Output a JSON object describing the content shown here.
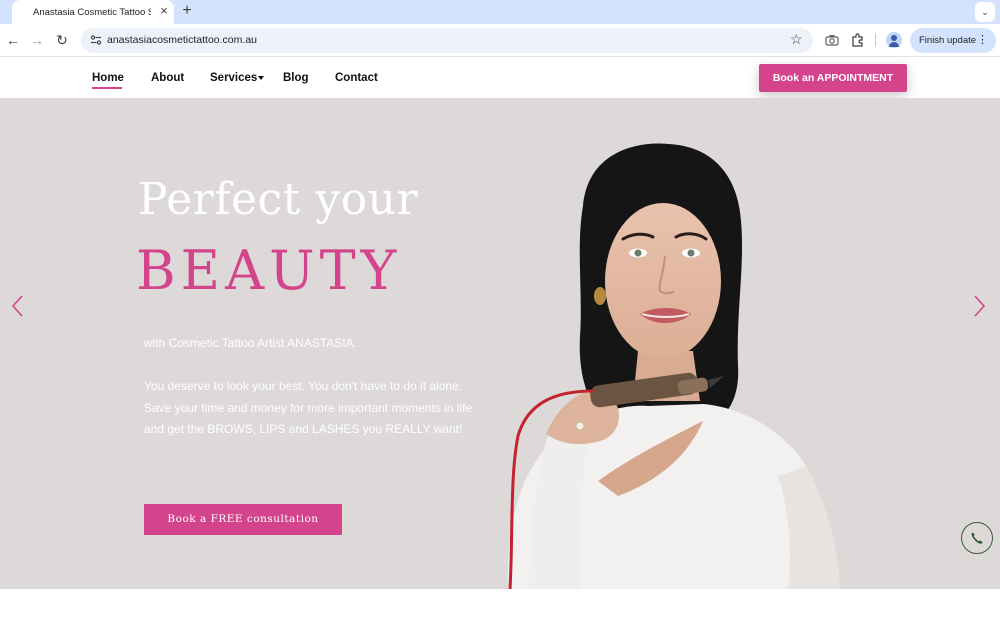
{
  "browser": {
    "tab_title": "Anastasia Cosmetic Tattoo St",
    "tab_close": "×",
    "new_tab": "+",
    "tab_menu": "⌄",
    "back": "←",
    "forward": "→",
    "reload": "↻",
    "url": "anastasiacosmetictattoo.com.au",
    "bookmark_star": "☆",
    "finish_update_label": "Finish update",
    "menu_dots": "⋮"
  },
  "nav": {
    "items": [
      {
        "label": "Home",
        "active": true
      },
      {
        "label": "About"
      },
      {
        "label": "Services",
        "has_dropdown": true
      },
      {
        "label": "Blog"
      },
      {
        "label": "Contact"
      }
    ],
    "book_button": "Book an APPOINTMENT"
  },
  "hero": {
    "title_line1": "Perfect your",
    "title_line2": "BEAUTY",
    "subtitle": "with Cosmetic Tattoo Artist ANASTASIA.",
    "body_line1": "You deserve to look your best. You don't have to do it alone.",
    "body_line2": "Save your time and money for more important moments in life and get the BROWS, LIPS and LASHES you REALLY want!",
    "cta_label": "Book a FREE consultation"
  },
  "colors": {
    "accent": "#d4448c",
    "hero_bg": "#dcd9d8",
    "chrome_tab_bar": "#d3e3fd"
  },
  "icons": {
    "slider_prev": "chevron-left-icon",
    "slider_next": "chevron-right-icon",
    "floating_call": "phone-icon"
  }
}
